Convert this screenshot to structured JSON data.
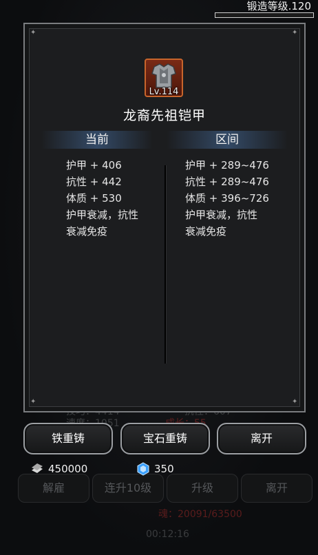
{
  "forge": {
    "level_label": "锻造等级.120",
    "progress": 0.0
  },
  "item": {
    "level": "Lv.114",
    "name": "龙裔先祖铠甲",
    "icon": "armor-icon"
  },
  "columns": {
    "current": "当前",
    "range": "区间"
  },
  "current_stats": [
    "护甲 + 406",
    "抗性 + 442",
    "体质 + 530",
    "护甲衰减，抗性",
    "衰减免疫"
  ],
  "range_stats": [
    "护甲 + 289~476",
    "抗性 + 289~476",
    "体质 + 396~726",
    "护甲衰减，抗性",
    "衰减免疫"
  ],
  "buttons": {
    "iron_recast": "铁重铸",
    "gem_recast": "宝石重铸",
    "leave": "离开"
  },
  "currency": {
    "silver": "450000",
    "gem": "350"
  },
  "background": {
    "skill": "技巧：4414",
    "resist": "抗性：607",
    "speed": "速度：1051",
    "growth": "成长：55",
    "dismiss": "解雇",
    "level_up_10": "连升10级",
    "level_up": "升级",
    "leave": "离开",
    "soul": "魂：20091/63500",
    "timer": "00:12:16"
  },
  "colors": {
    "accent": "#c8652c",
    "header_blue": "#466ea0"
  }
}
